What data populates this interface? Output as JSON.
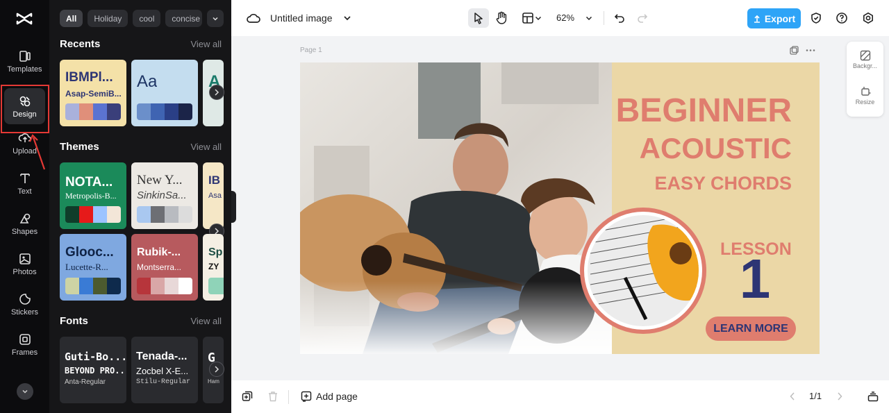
{
  "rail": {
    "items": [
      {
        "label": "Templates",
        "icon": "templates-icon"
      },
      {
        "label": "Design",
        "icon": "design-icon"
      },
      {
        "label": "Upload",
        "icon": "upload-icon"
      },
      {
        "label": "Text",
        "icon": "text-icon"
      },
      {
        "label": "Shapes",
        "icon": "shapes-icon"
      },
      {
        "label": "Photos",
        "icon": "photos-icon"
      },
      {
        "label": "Stickers",
        "icon": "stickers-icon"
      },
      {
        "label": "Frames",
        "icon": "frames-icon"
      }
    ],
    "active": "Design"
  },
  "panel": {
    "chips": [
      "All",
      "Holiday",
      "cool",
      "concise"
    ],
    "recents": {
      "title": "Recents",
      "view_all": "View all",
      "cards": [
        {
          "t1": "IBMPl...",
          "t2": "Asap-SemiB...",
          "bg": "#f4e1a8",
          "fg": "#2d3574",
          "swatches": [
            "#a9b1dc",
            "#e08f7a",
            "#5b73d1",
            "#3a3f7a"
          ]
        },
        {
          "t1": "Aa",
          "t2": "",
          "bg": "#c4ddef",
          "fg": "#1e3565",
          "swatches": [
            "#6b8fca",
            "#3f64b2",
            "#2a3f86",
            "#1b2448"
          ]
        },
        {
          "t1": "A",
          "t2": "",
          "bg": "#dfe9e6",
          "fg": "#1a7a6a",
          "swatches": []
        }
      ]
    },
    "themes": {
      "title": "Themes",
      "view_all": "View all",
      "cards": [
        {
          "t1": "NOTA...",
          "t2": "Metropolis-B...",
          "bg": "#1b8a5a",
          "fg": "#ffffff",
          "swatches": [
            "#0f3d2a",
            "#e61a1a",
            "#9cc3ff",
            "#f3e6d8"
          ]
        },
        {
          "t1": "New Y...",
          "t2": "SinkinSa...",
          "bg": "#ece9e4",
          "fg": "#333333",
          "swatches": [
            "#a9c8f0",
            "#6d6f74",
            "#b8bbc0",
            "#dcdcdc"
          ]
        },
        {
          "t1": "IB",
          "t2": "Asa",
          "bg": "#f5e7c6",
          "fg": "#2d3574",
          "swatches": []
        },
        {
          "t1": "Glooc...",
          "t2": "Lucette-R...",
          "bg": "#7fa8e0",
          "fg": "#0f2346",
          "swatches": [
            "#cdd3a4",
            "#3a7bd5",
            "#4c5a2f",
            "#0e2a4c"
          ]
        },
        {
          "t1": "Rubik-...",
          "t2": "Montserra...",
          "bg": "#b75a5e",
          "fg": "#ffffff",
          "swatches": [
            "#b7353b",
            "#d9a7a7",
            "#e8d8d8",
            "#ffffff"
          ]
        },
        {
          "t1": "Sp",
          "t2": "ZY",
          "bg": "#f4efe4",
          "fg": "#1d4e44",
          "swatches": []
        }
      ]
    },
    "fonts": {
      "title": "Fonts",
      "view_all": "View all",
      "cards": [
        {
          "f1": "Guti-Bo...",
          "f2": "BEYOND PRO...",
          "f3": "Anta-Regular"
        },
        {
          "f1": "Tenada-...",
          "f2": "Zocbel X-E...",
          "f3": "Stilu-Regular"
        },
        {
          "f1": "G",
          "f2": "",
          "f3": "Ham"
        }
      ]
    }
  },
  "topbar": {
    "title": "Untitled image",
    "zoom": "62%",
    "export_label": "Export"
  },
  "canvas": {
    "page_label": "Page 1",
    "design": {
      "line1": "BEGINNER",
      "line2": "ACOUSTIC",
      "line3": "EASY CHORDS",
      "lesson": "LESSON",
      "number": "1",
      "button": "LEARN MORE",
      "accent": "#df7d6e",
      "navy": "#2d3574",
      "background": "#ebd7a6"
    }
  },
  "right_float": {
    "background_label": "Backgr...",
    "resize_label": "Resize"
  },
  "bottombar": {
    "add_page": "Add page",
    "pager": "1/1"
  }
}
